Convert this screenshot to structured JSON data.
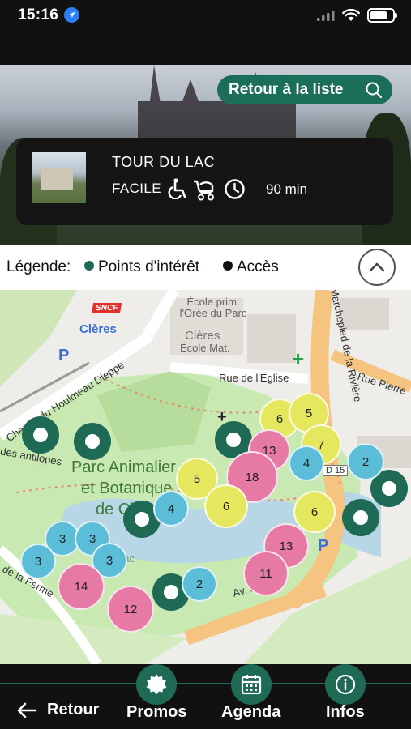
{
  "status": {
    "time": "15:16"
  },
  "header": {
    "back_to_list": "Retour à la liste"
  },
  "trail": {
    "name": "TOUR DU LAC",
    "difficulty": "FACILE",
    "duration": "90 min",
    "features": [
      "wheelchair-icon",
      "stroller-icon",
      "clock-icon"
    ]
  },
  "legend": {
    "label": "Légende:",
    "items": [
      {
        "label": "Points d'intérêt",
        "color": "#1e6a55"
      },
      {
        "label": "Accès",
        "color": "#111111"
      }
    ]
  },
  "map": {
    "labels": {
      "sncf": "SNCF",
      "station": "Clères",
      "school": "École prim. l'Orée du Parc",
      "town": "Clères",
      "school2": "École Mat.",
      "rue_eglise": "Rue de l'Église",
      "rue_pierre": "Rue Pierre",
      "marchepied": "Marchepied de la Rivière",
      "parc": "Parc Animalier",
      "parc2": "et Botanique",
      "parc3": "de Clères",
      "antilopes": "des antilopes",
      "ferme": "de la Ferme",
      "avenue": "Av. du Parc",
      "houlmeau": "Chemin du Houlmeau Dieppe",
      "lac": "Lac",
      "road_badge": "D 15"
    },
    "clusters": [
      {
        "count": "6",
        "kind": "yellow"
      },
      {
        "count": "5",
        "kind": "yellow"
      },
      {
        "count": "7",
        "kind": "yellow"
      },
      {
        "count": "13",
        "kind": "pink"
      },
      {
        "count": "4",
        "kind": "blue"
      },
      {
        "count": "18",
        "kind": "pink"
      },
      {
        "count": "2",
        "kind": "blue"
      },
      {
        "count": "5",
        "kind": "yellow"
      },
      {
        "count": "6",
        "kind": "yellow"
      },
      {
        "count": "6",
        "kind": "yellow"
      },
      {
        "count": "4",
        "kind": "blue"
      },
      {
        "count": "3",
        "kind": "blue"
      },
      {
        "count": "3",
        "kind": "blue"
      },
      {
        "count": "3",
        "kind": "blue"
      },
      {
        "count": "3",
        "kind": "blue"
      },
      {
        "count": "13",
        "kind": "pink"
      },
      {
        "count": "11",
        "kind": "pink"
      },
      {
        "count": "14",
        "kind": "pink"
      },
      {
        "count": "12",
        "kind": "pink"
      },
      {
        "count": "2",
        "kind": "blue"
      }
    ]
  },
  "bottom_nav": {
    "back": "Retour",
    "promos": "Promos",
    "agenda": "Agenda",
    "infos": "Infos"
  },
  "colors": {
    "accent": "#1e6a55",
    "yellow": "#e5e85f",
    "pink": "#e67aa5",
    "blue": "#5bbdd8"
  }
}
